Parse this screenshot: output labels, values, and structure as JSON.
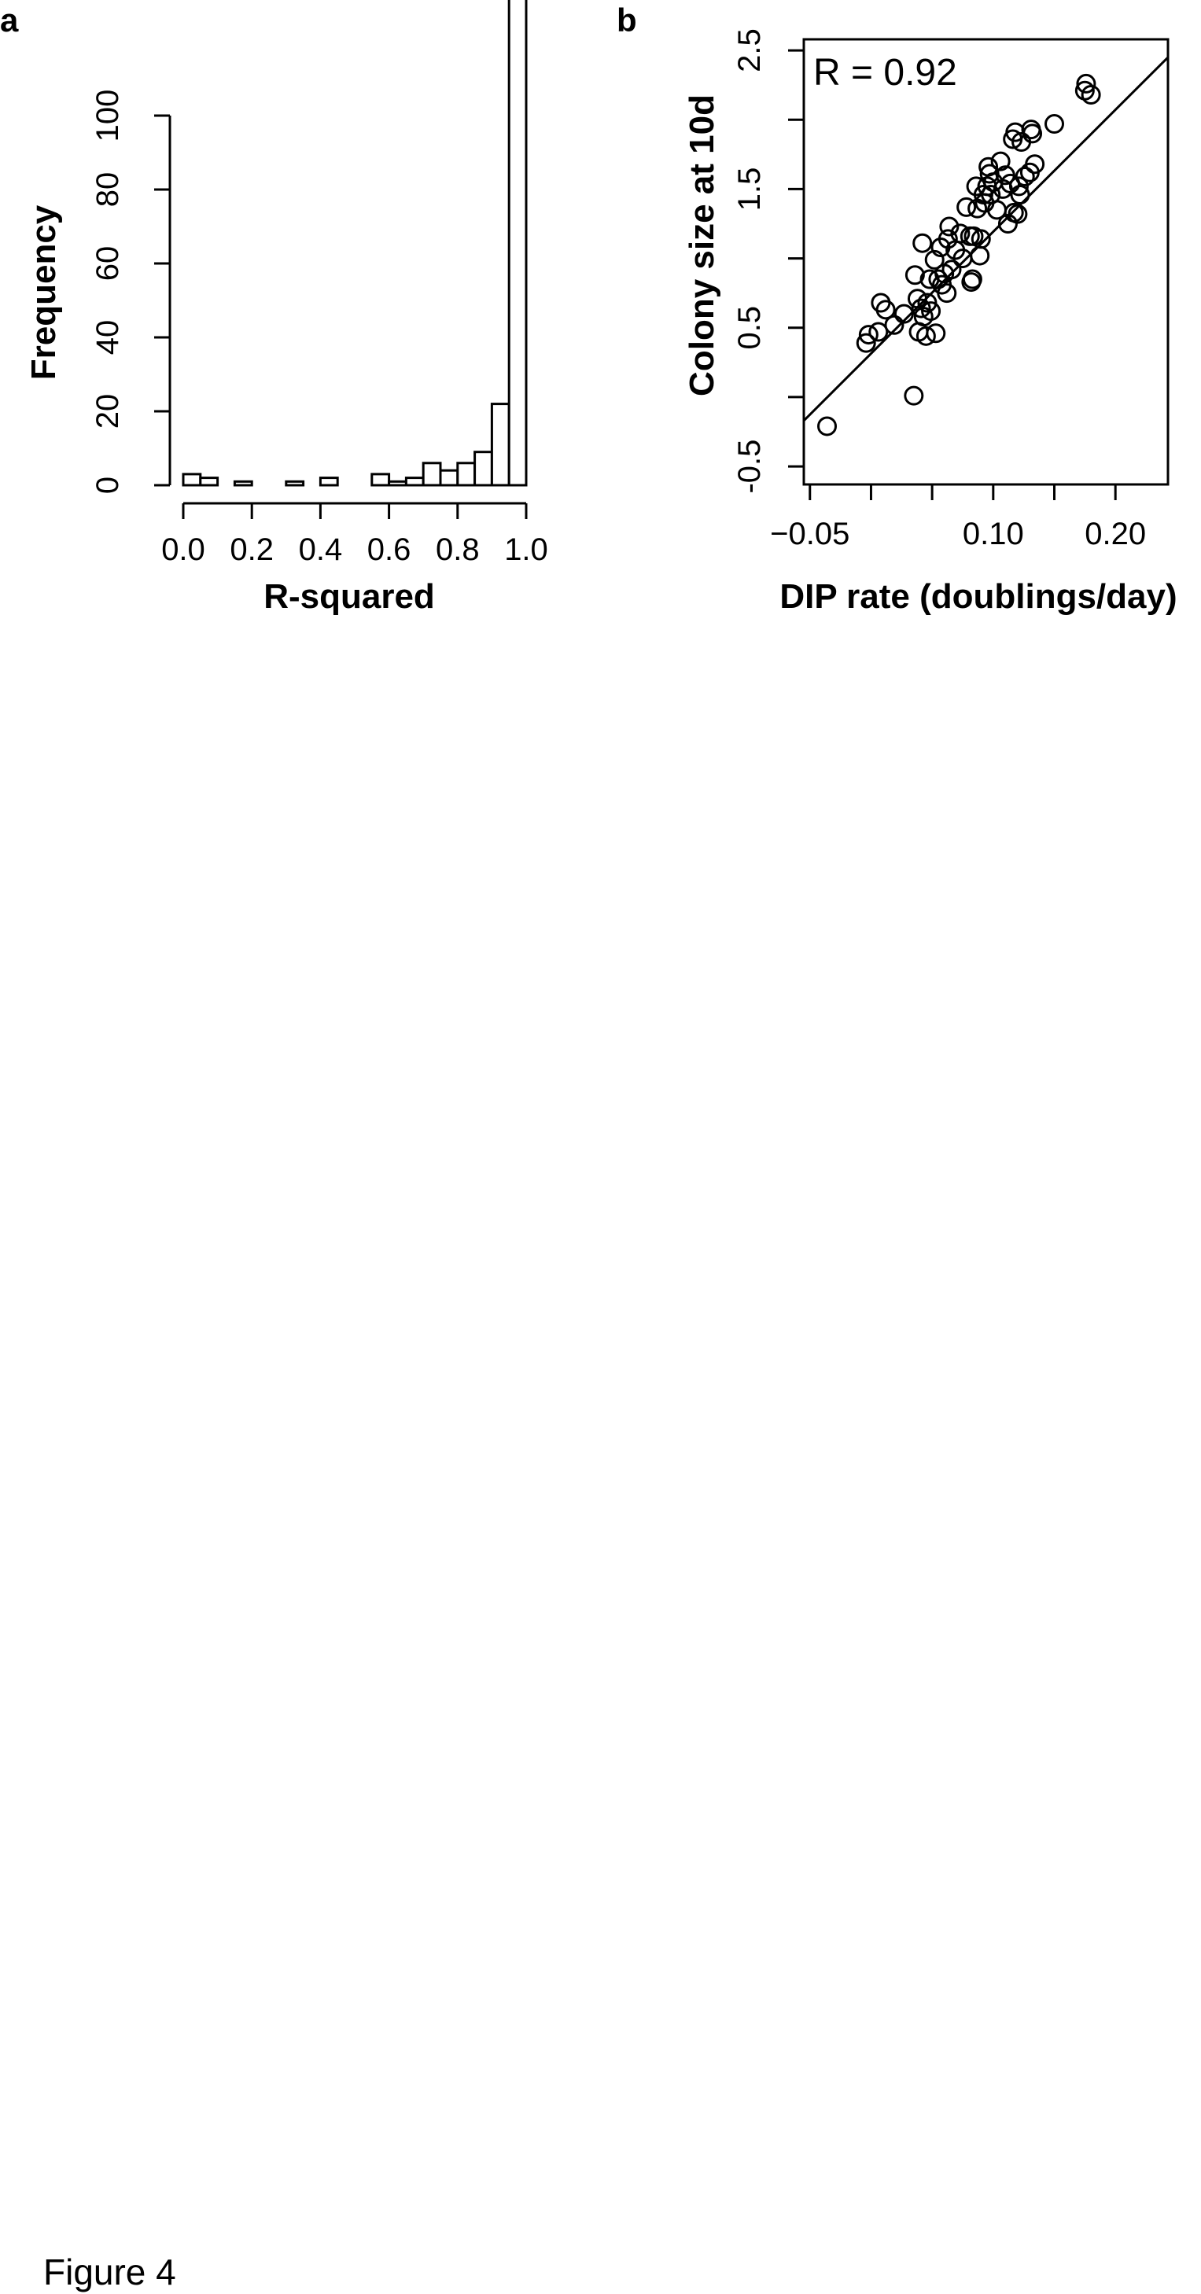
{
  "figure_caption": "Figure 4",
  "chart_data": [
    {
      "panel": "a",
      "type": "bar",
      "xlabel": "R-squared",
      "ylabel": "Frequency",
      "xlim": [
        0,
        1
      ],
      "ylim": [
        0,
        120
      ],
      "x_ticks": [
        "0.0",
        "0.2",
        "0.4",
        "0.6",
        "0.8",
        "1.0"
      ],
      "y_ticks": [
        "0",
        "20",
        "40",
        "60",
        "80",
        "100"
      ],
      "bin_width": 0.05,
      "bins": [
        {
          "start": 0.0,
          "count": 3
        },
        {
          "start": 0.05,
          "count": 2
        },
        {
          "start": 0.1,
          "count": 0
        },
        {
          "start": 0.15,
          "count": 1
        },
        {
          "start": 0.2,
          "count": 0
        },
        {
          "start": 0.25,
          "count": 0
        },
        {
          "start": 0.3,
          "count": 1
        },
        {
          "start": 0.35,
          "count": 0
        },
        {
          "start": 0.4,
          "count": 2
        },
        {
          "start": 0.45,
          "count": 0
        },
        {
          "start": 0.5,
          "count": 0
        },
        {
          "start": 0.55,
          "count": 3
        },
        {
          "start": 0.6,
          "count": 1
        },
        {
          "start": 0.65,
          "count": 2
        },
        {
          "start": 0.7,
          "count": 6
        },
        {
          "start": 0.75,
          "count": 4
        },
        {
          "start": 0.8,
          "count": 6
        },
        {
          "start": 0.85,
          "count": 9
        },
        {
          "start": 0.9,
          "count": 22
        },
        {
          "start": 0.95,
          "count": 133
        }
      ]
    },
    {
      "panel": "b",
      "type": "scatter",
      "xlabel": "DIP rate (doublings/day)",
      "ylabel": "Colony size at 10d",
      "annotation": "R =  0.92",
      "xlim": [
        -0.055,
        0.243
      ],
      "ylim": [
        -0.63,
        2.58
      ],
      "x_ticks": [
        {
          "value": -0.05,
          "label": "−0.05"
        },
        {
          "value": 0.1,
          "label": "0.10"
        },
        {
          "value": 0.2,
          "label": "0.20"
        }
      ],
      "x_minor_ticks": [
        0.0,
        0.05,
        0.15
      ],
      "y_ticks": [
        {
          "value": -0.5,
          "label": "-0.5"
        },
        {
          "value": 0.5,
          "label": "0.5"
        },
        {
          "value": 1.5,
          "label": "1.5"
        },
        {
          "value": 2.5,
          "label": "2.5"
        }
      ],
      "y_minor_ticks": [
        0.0,
        1.0,
        2.0
      ],
      "fit_line": {
        "x": [
          -0.055,
          0.243
        ],
        "y": [
          -0.17,
          2.45
        ]
      },
      "points": [
        [
          -0.036,
          -0.21
        ],
        [
          -0.004,
          0.39
        ],
        [
          -0.002,
          0.45
        ],
        [
          0.006,
          0.47
        ],
        [
          0.008,
          0.68
        ],
        [
          0.012,
          0.63
        ],
        [
          0.019,
          0.52
        ],
        [
          0.027,
          0.6
        ],
        [
          0.035,
          0.01
        ],
        [
          0.036,
          0.88
        ],
        [
          0.038,
          0.71
        ],
        [
          0.039,
          0.47
        ],
        [
          0.041,
          0.64
        ],
        [
          0.042,
          1.11
        ],
        [
          0.043,
          0.58
        ],
        [
          0.045,
          0.44
        ],
        [
          0.046,
          0.68
        ],
        [
          0.048,
          0.85
        ],
        [
          0.049,
          0.62
        ],
        [
          0.052,
          0.99
        ],
        [
          0.053,
          0.46
        ],
        [
          0.055,
          0.85
        ],
        [
          0.057,
          1.08
        ],
        [
          0.058,
          0.81
        ],
        [
          0.06,
          0.89
        ],
        [
          0.062,
          0.75
        ],
        [
          0.063,
          1.14
        ],
        [
          0.064,
          1.23
        ],
        [
          0.066,
          0.92
        ],
        [
          0.069,
          1.06
        ],
        [
          0.073,
          1.18
        ],
        [
          0.075,
          1.0
        ],
        [
          0.078,
          1.37
        ],
        [
          0.081,
          1.16
        ],
        [
          0.082,
          0.83
        ],
        [
          0.083,
          0.85
        ],
        [
          0.084,
          1.16
        ],
        [
          0.086,
          1.52
        ],
        [
          0.087,
          1.36
        ],
        [
          0.089,
          1.02
        ],
        [
          0.09,
          1.14
        ],
        [
          0.092,
          1.46
        ],
        [
          0.093,
          1.4
        ],
        [
          0.095,
          1.52
        ],
        [
          0.096,
          1.66
        ],
        [
          0.097,
          1.61
        ],
        [
          0.098,
          1.46
        ],
        [
          0.1,
          1.55
        ],
        [
          0.103,
          1.35
        ],
        [
          0.106,
          1.7
        ],
        [
          0.108,
          1.5
        ],
        [
          0.11,
          1.6
        ],
        [
          0.112,
          1.25
        ],
        [
          0.114,
          1.54
        ],
        [
          0.116,
          1.86
        ],
        [
          0.117,
          1.33
        ],
        [
          0.118,
          1.91
        ],
        [
          0.12,
          1.32
        ],
        [
          0.121,
          1.52
        ],
        [
          0.122,
          1.46
        ],
        [
          0.123,
          1.84
        ],
        [
          0.126,
          1.59
        ],
        [
          0.13,
          1.62
        ],
        [
          0.131,
          1.93
        ],
        [
          0.132,
          1.9
        ],
        [
          0.134,
          1.68
        ],
        [
          0.15,
          1.97
        ],
        [
          0.175,
          2.21
        ],
        [
          0.176,
          2.26
        ],
        [
          0.18,
          2.18
        ]
      ]
    }
  ]
}
